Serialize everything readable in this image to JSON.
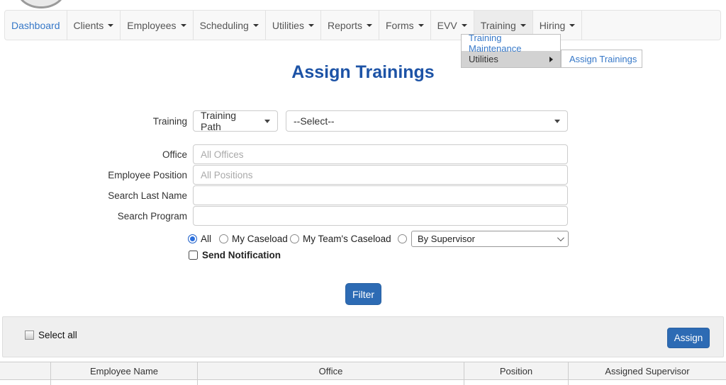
{
  "colors": {
    "link_blue": "#3678c8",
    "title_blue": "#1d53a6",
    "button_blue": "#2d6bb4",
    "radio_selected_blue": "#2b6fdd",
    "navbar_bg": "#f8f8f8"
  },
  "navbar": {
    "items": [
      {
        "label": "Dashboard"
      },
      {
        "label": "Clients"
      },
      {
        "label": "Employees"
      },
      {
        "label": "Scheduling"
      },
      {
        "label": "Utilities"
      },
      {
        "label": "Reports"
      },
      {
        "label": "Forms"
      },
      {
        "label": "EVV"
      },
      {
        "label": "Training"
      },
      {
        "label": "Hiring"
      }
    ]
  },
  "training_menu": {
    "items": [
      {
        "label": "Training Maintenance"
      },
      {
        "label": "Utilities"
      }
    ],
    "submenu_items": [
      {
        "label": "Assign Trainings"
      }
    ]
  },
  "page": {
    "title": "Assign Trainings"
  },
  "form": {
    "training_label": "Training",
    "training_type_value": "Training Path",
    "training_value": "--Select--",
    "office_label": "Office",
    "office_placeholder": "All Offices",
    "position_label": "Employee Position",
    "position_placeholder": "All Positions",
    "last_name_label": "Search Last Name",
    "program_label": "Search Program",
    "radio_all_label": "All",
    "radio_my_caseload_label": "My Caseload",
    "radio_team_caseload_label": "My Team's Caseload",
    "supervisor_value": "By Supervisor",
    "send_notification_label": "Send Notification",
    "filter_button_label": "Filter"
  },
  "results": {
    "select_all_label": "Select all",
    "assign_button_label": "Assign",
    "table_headers": [
      "",
      "Employee Name",
      "Office",
      "Position",
      "Assigned Supervisor"
    ]
  }
}
